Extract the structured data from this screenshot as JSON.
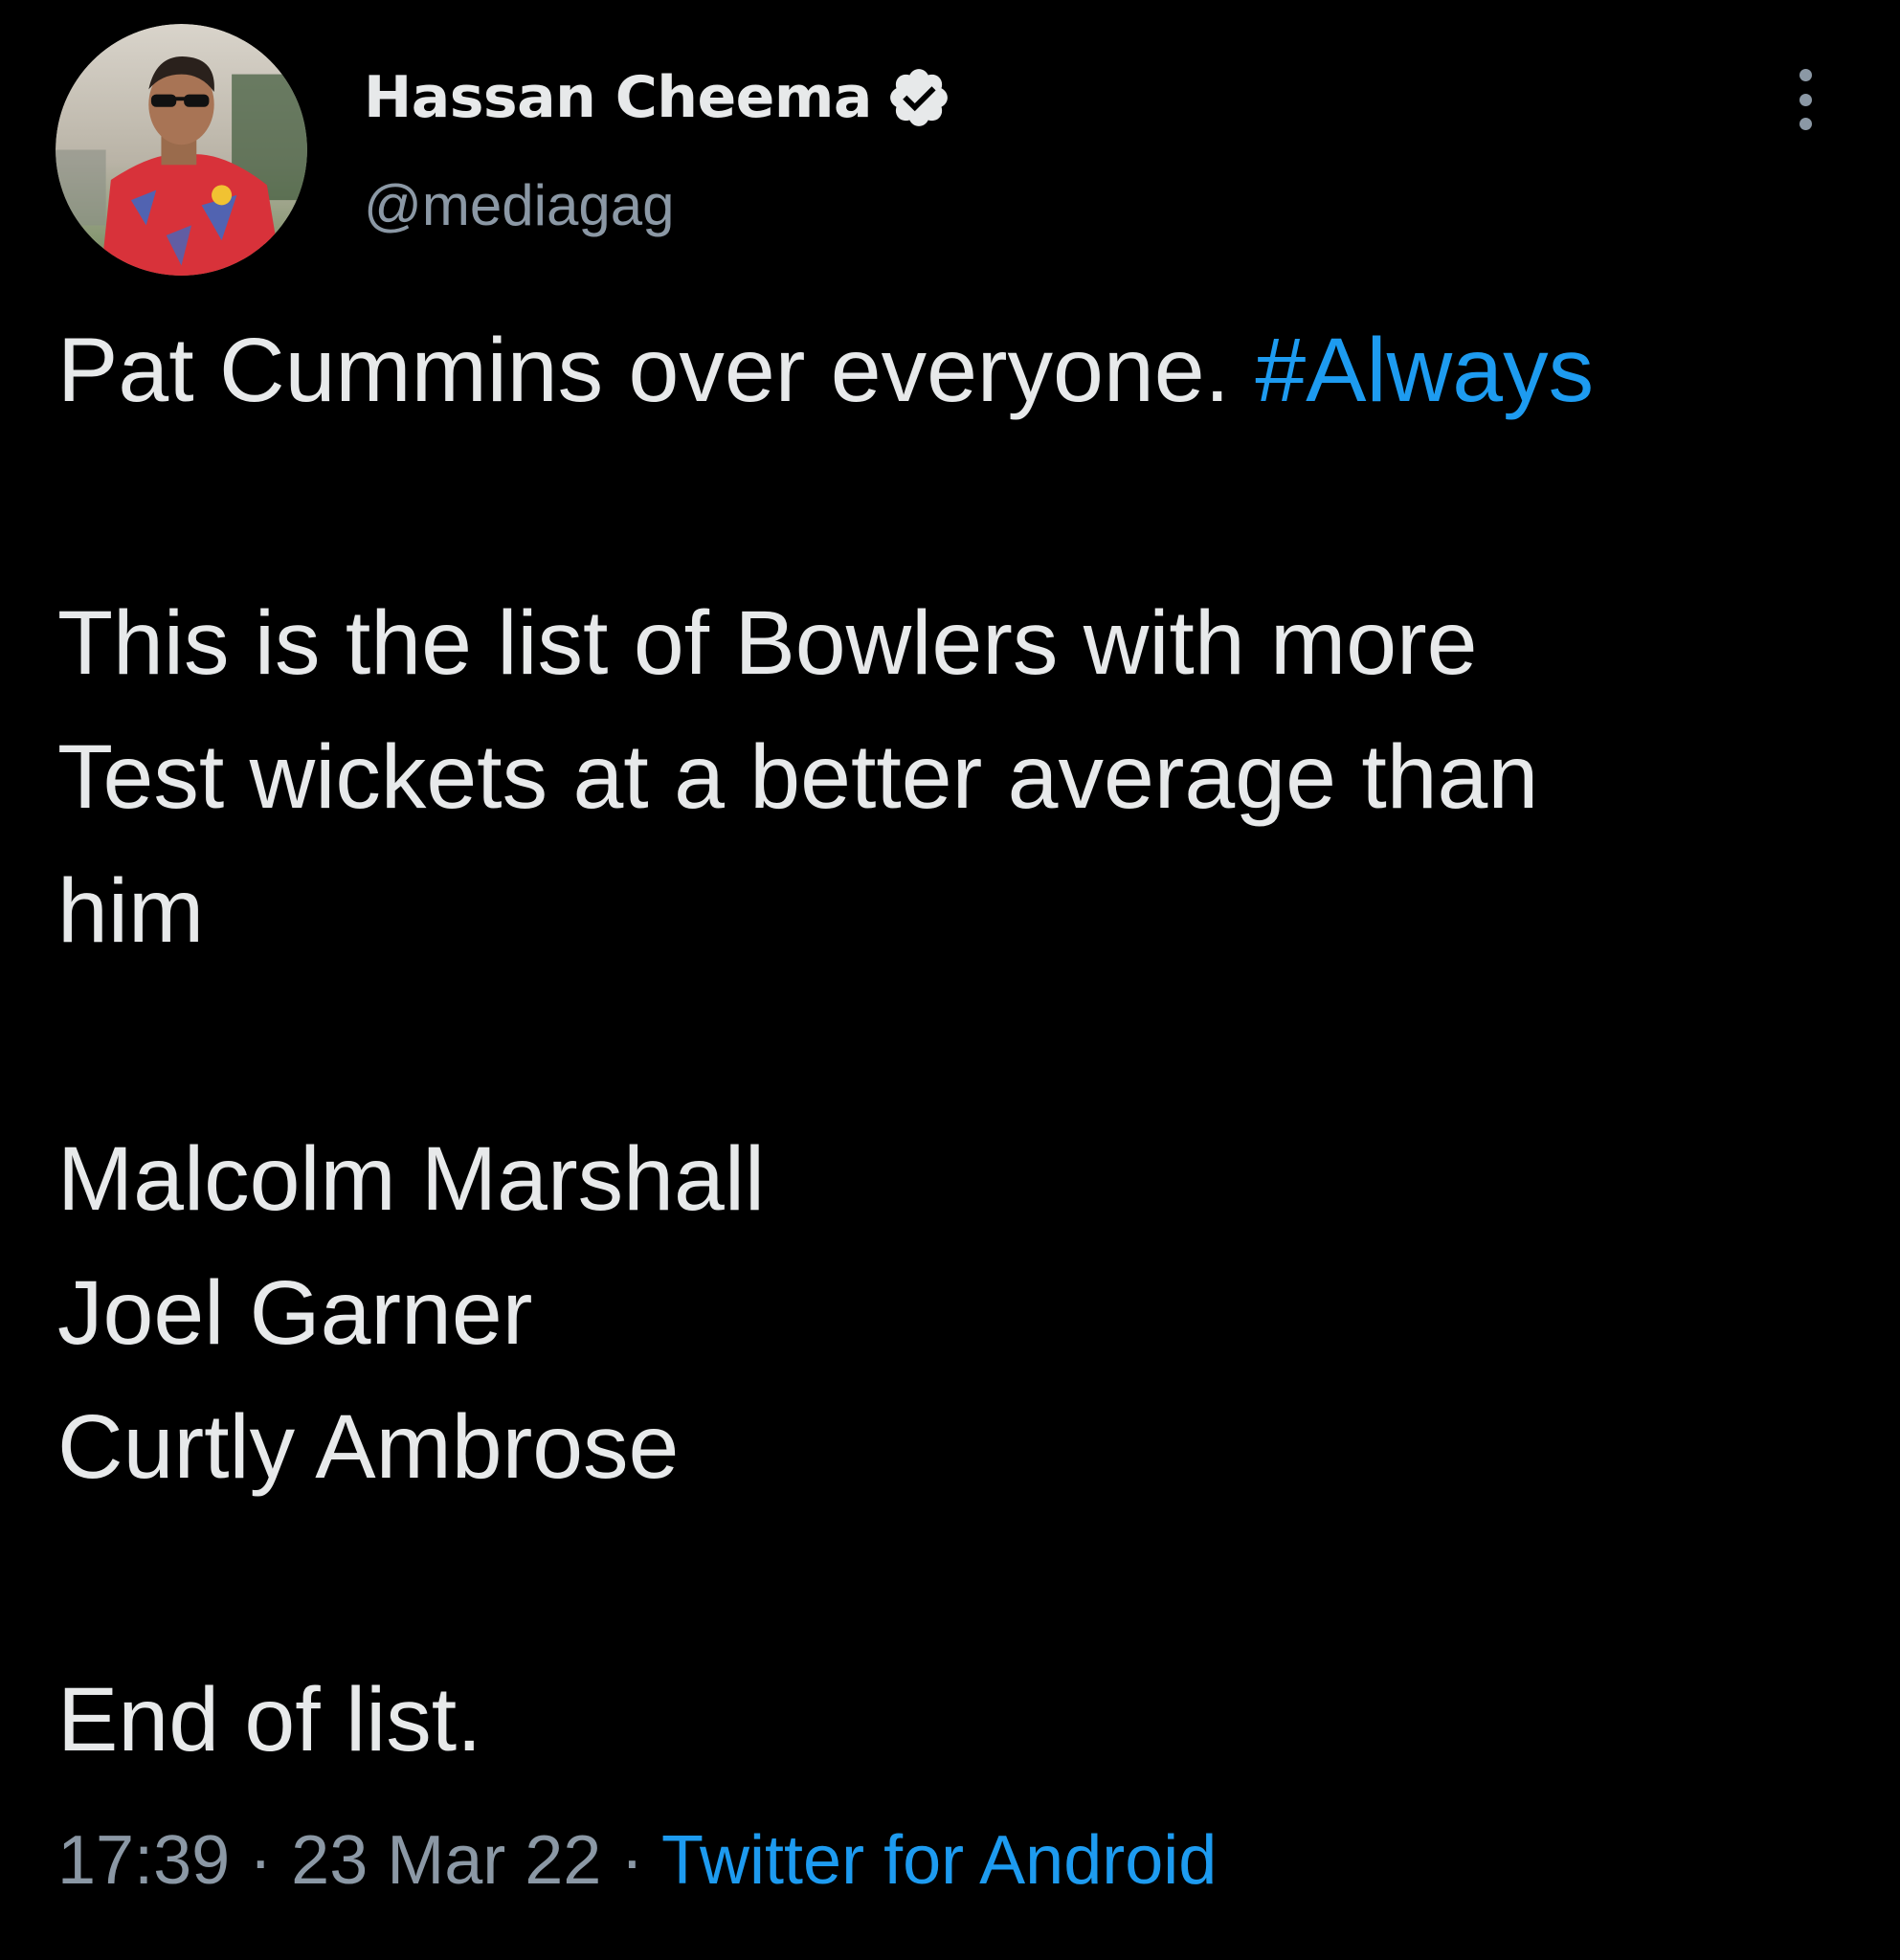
{
  "author": {
    "display_name": "Hassan Cheema",
    "handle": "@mediagag",
    "verified": true
  },
  "tweet": {
    "line1_text": "Pat Cummins over everyone. ",
    "line1_hashtag": "#Always",
    "line2": "This is the list of Bowlers with more",
    "line3": "Test wickets at a better average than",
    "line4": "him",
    "list_item1": "Malcolm Marshall",
    "list_item2": "Joel Garner",
    "list_item3": "Curtly Ambrose",
    "closing": "End of list."
  },
  "meta": {
    "time": "17:39",
    "separator1": " · ",
    "date": "23 Mar 22",
    "separator2": " · ",
    "source": "Twitter for Android"
  },
  "colors": {
    "background": "#000000",
    "text_primary": "#e7e9ea",
    "text_secondary": "#8b98a5",
    "accent": "#1d9bf0"
  },
  "icons": {
    "verified": "verified-badge-icon",
    "more": "more-vertical-icon",
    "avatar": "profile-photo"
  }
}
